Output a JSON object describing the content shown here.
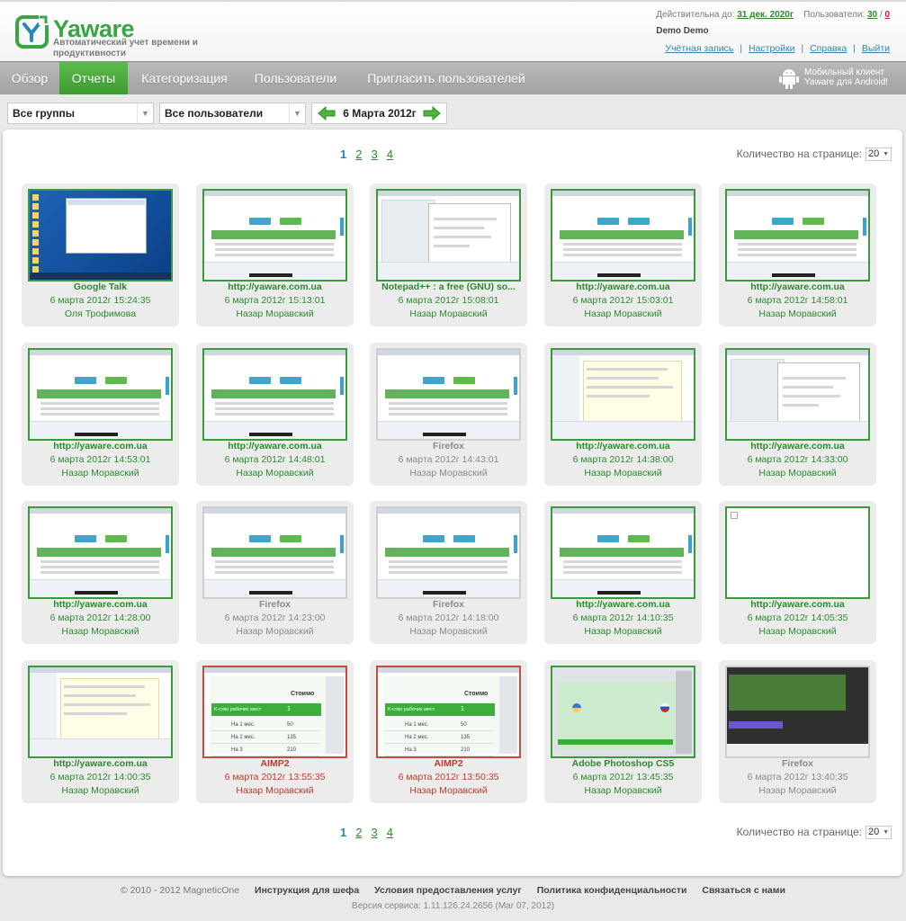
{
  "brand": {
    "name": "Yaware",
    "tagline": "Автоматический учет времени и продуктивности"
  },
  "account": {
    "valid_prefix": "Действительна до:",
    "valid_until": "31 дек. 2020г",
    "users_prefix": "Пользователи:",
    "users_count": "30",
    "users_sep": "/",
    "users_extra": "0",
    "user_name": "Demo Demo",
    "links": [
      "Учётная запись",
      "Настройки",
      "Справка",
      "Выйти"
    ],
    "link_sep": "|"
  },
  "nav": {
    "items": [
      "Обзор",
      "Отчеты",
      "Категоризация",
      "Пользователи",
      "Пригласить пользователей"
    ],
    "active_index": 1,
    "android_text": "Мобильный клиент Yaware для Android!"
  },
  "filters": {
    "group": "Все группы",
    "user": "Все пользователи",
    "date": "6 Марта 2012г"
  },
  "pagination": {
    "current": "1",
    "pages": [
      "2",
      "3",
      "4"
    ],
    "per_page_label": "Количество на странице:",
    "per_page_value": "20"
  },
  "cards": [
    {
      "title": "Google Talk",
      "time": "6 марта 2012г 15:24:35",
      "user": "Оля Трофимова",
      "color": "green",
      "thumb": "desktop"
    },
    {
      "title": "http://yaware.com.ua",
      "time": "6 марта 2012г 15:13:01",
      "user": "Назар Моравский",
      "color": "green",
      "thumb": "web"
    },
    {
      "title": "Notepad++ : a free (GNU) so...",
      "time": "6 марта 2012г 15:08:01",
      "user": "Назар Моравский",
      "color": "green",
      "thumb": "code"
    },
    {
      "title": "http://yaware.com.ua",
      "time": "6 марта 2012г 15:03:01",
      "user": "Назар Моравский",
      "color": "green",
      "thumb": "web"
    },
    {
      "title": "http://yaware.com.ua",
      "time": "6 марта 2012г 14:58:01",
      "user": "Назар Моравский",
      "color": "green",
      "thumb": "web"
    },
    {
      "title": "http://yaware.com.ua",
      "time": "6 марта 2012г 14:53:01",
      "user": "Назар Моравский",
      "color": "green",
      "thumb": "web"
    },
    {
      "title": "http://yaware.com.ua",
      "time": "6 марта 2012г 14:48:01",
      "user": "Назар Моравский",
      "color": "green",
      "thumb": "web"
    },
    {
      "title": "Firefox",
      "time": "6 марта 2012г 14:43:01",
      "user": "Назар Моравский",
      "color": "gray",
      "thumb": "web"
    },
    {
      "title": "http://yaware.com.ua",
      "time": "6 марта 2012г 14:38:00",
      "user": "Назар Моравский",
      "color": "green",
      "thumb": "doc"
    },
    {
      "title": "http://yaware.com.ua",
      "time": "6 марта 2012г 14:33:00",
      "user": "Назар Моравский",
      "color": "green",
      "thumb": "code"
    },
    {
      "title": "http://yaware.com.ua",
      "time": "6 марта 2012г 14:28:00",
      "user": "Назар Моравский",
      "color": "green",
      "thumb": "web"
    },
    {
      "title": "Firefox",
      "time": "6 марта 2012г 14:23:00",
      "user": "Назар Моравский",
      "color": "gray",
      "thumb": "web"
    },
    {
      "title": "Firefox",
      "time": "6 марта 2012г 14:18:00",
      "user": "Назар Моравский",
      "color": "gray",
      "thumb": "web"
    },
    {
      "title": "http://yaware.com.ua",
      "time": "6 марта 2012г 14:10:35",
      "user": "Назар Моравский",
      "color": "green",
      "thumb": "web"
    },
    {
      "title": "http://yaware.com.ua",
      "time": "6 марта 2012г 14:05:35",
      "user": "Назар Моравский",
      "color": "green",
      "thumb": "blank"
    },
    {
      "title": "http://yaware.com.ua",
      "time": "6 марта 2012г 14:00:35",
      "user": "Назар Моравский",
      "color": "green",
      "thumb": "doc"
    },
    {
      "title": "AIMP2",
      "time": "6 марта 2012г 13:55:35",
      "user": "Назар Моравский",
      "color": "red",
      "thumb": "table"
    },
    {
      "title": "AIMP2",
      "time": "6 марта 2012г 13:50:35",
      "user": "Назар Моравский",
      "color": "red",
      "thumb": "table"
    },
    {
      "title": "Adobe Photoshop CS5",
      "time": "6 марта 2012г 13:45:35",
      "user": "Назар Моравский",
      "color": "green",
      "thumb": "ps"
    },
    {
      "title": "Firefox",
      "time": "6 марта 2012г 13:40:35",
      "user": "Назар Моравский",
      "color": "gray",
      "thumb": "dark"
    }
  ],
  "thumb_table": {
    "header": "Стоимо",
    "row_label": "К-ство рабочих мест",
    "row_value": "1",
    "rows": [
      {
        "label": "На 1 мес.",
        "value": "50"
      },
      {
        "label": "На 2 мес.",
        "value": "135"
      },
      {
        "label": "На 3",
        "value": "210"
      }
    ]
  },
  "footer": {
    "copyright": "© 2010 - 2012 MagneticOne",
    "links": [
      "Инструкция для шефа",
      "Условия предоставления услуг",
      "Политика конфиденциальности",
      "Связаться с нами"
    ],
    "version": "Версия сервиса: 1.11.126.24.2656 (Mar 07, 2012)"
  },
  "colors": {
    "brand_green": "#3aa544",
    "link_blue": "#2a86b5",
    "nav_active": "#4aa93c",
    "alert_red": "#c0392b"
  }
}
